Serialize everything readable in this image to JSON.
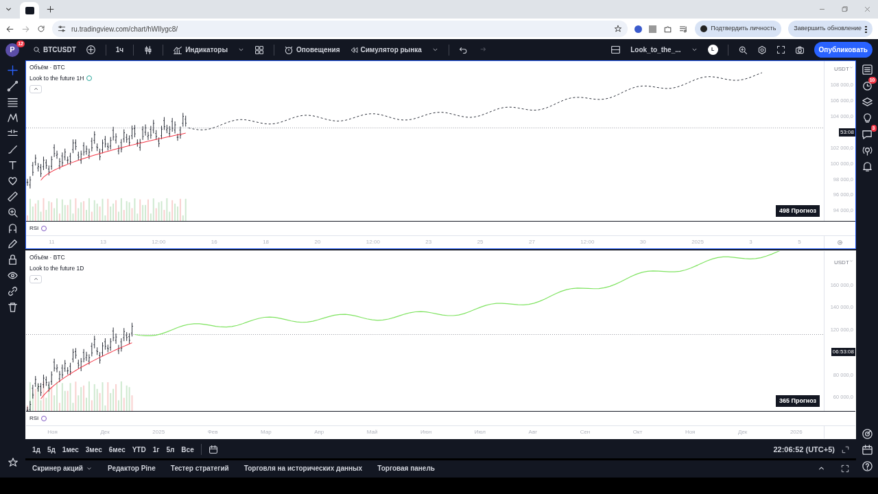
{
  "browser": {
    "address": "ru.tradingview.com/chart/hWIlygc8/",
    "verify_button": "Подтвердить личность",
    "update_button": "Завершить обновление"
  },
  "toolbar": {
    "avatar": "P",
    "avatar_badge": "12",
    "symbol": "BTCUSDT",
    "interval": "1ч",
    "indicators": "Индикаторы",
    "alerts": "Оповещения",
    "replay": "Симулятор рынка",
    "layout_name": "Look_to_the_...",
    "user_initial": "L",
    "publish": "Опубликовать"
  },
  "panes": [
    {
      "kind": "hourly",
      "volume_label": "Объём · BTC",
      "indicator": "Look to the future 1H",
      "currency": "USDT",
      "forecast": "498 Прогноз",
      "rsi": "RSI",
      "price_axis": [
        {
          "kind": "tick",
          "text": "108 000,0"
        },
        {
          "kind": "tick",
          "text": "106 000,0"
        },
        {
          "kind": "tick",
          "text": "104 000,0"
        },
        {
          "kind": "tag",
          "text": "53:08"
        },
        {
          "kind": "tick",
          "text": "102 000,0"
        },
        {
          "kind": "tick",
          "text": "100 000,0"
        },
        {
          "kind": "tick",
          "text": "98 000,0"
        },
        {
          "kind": "tick",
          "text": "96 000,0"
        },
        {
          "kind": "tick",
          "text": "94 000,0"
        }
      ],
      "time_axis": [
        "11",
        "13",
        "12:00",
        "16",
        "18",
        "20",
        "12:00",
        "23",
        "25",
        "27",
        "12:00",
        "30",
        "2025",
        "3",
        "5"
      ]
    },
    {
      "kind": "daily",
      "volume_label": "Объём · BTC",
      "indicator": "Look to the future 1D",
      "currency": "USDT",
      "forecast": "365 Прогноз",
      "rsi": "RSI",
      "price_axis": [
        {
          "kind": "tick",
          "text": "160 000,0"
        },
        {
          "kind": "tick",
          "text": "140 000,0"
        },
        {
          "kind": "tick",
          "text": "120 000,0"
        },
        {
          "kind": "tag",
          "text": "06:53:08"
        },
        {
          "kind": "tick",
          "text": "80 000,0"
        },
        {
          "kind": "tick",
          "text": "60 000,0"
        }
      ],
      "time_axis": [
        "Ноя",
        "Дек",
        "2025",
        "Фев",
        "Мар",
        "Апр",
        "Май",
        "Июн",
        "Июл",
        "Авг",
        "Сен",
        "Окт",
        "Ноя",
        "Дек",
        "2026"
      ]
    }
  ],
  "ranges": [
    "1д",
    "5д",
    "1мес",
    "3мес",
    "6мес",
    "YTD",
    "1г",
    "5л",
    "Все"
  ],
  "clock": "22:06:52 (UTC+5)",
  "bottom_tabs": [
    {
      "label": "Скринер акций",
      "dropdown": true
    },
    {
      "label": "Редактор Pine",
      "dropdown": false
    },
    {
      "label": "Тестер стратегий",
      "dropdown": false
    },
    {
      "label": "Торговля на исторических данных",
      "dropdown": false
    },
    {
      "label": "Торговая панель",
      "dropdown": false
    }
  ],
  "sidebar_badges": {
    "alerts": "10",
    "chat": "3"
  }
}
